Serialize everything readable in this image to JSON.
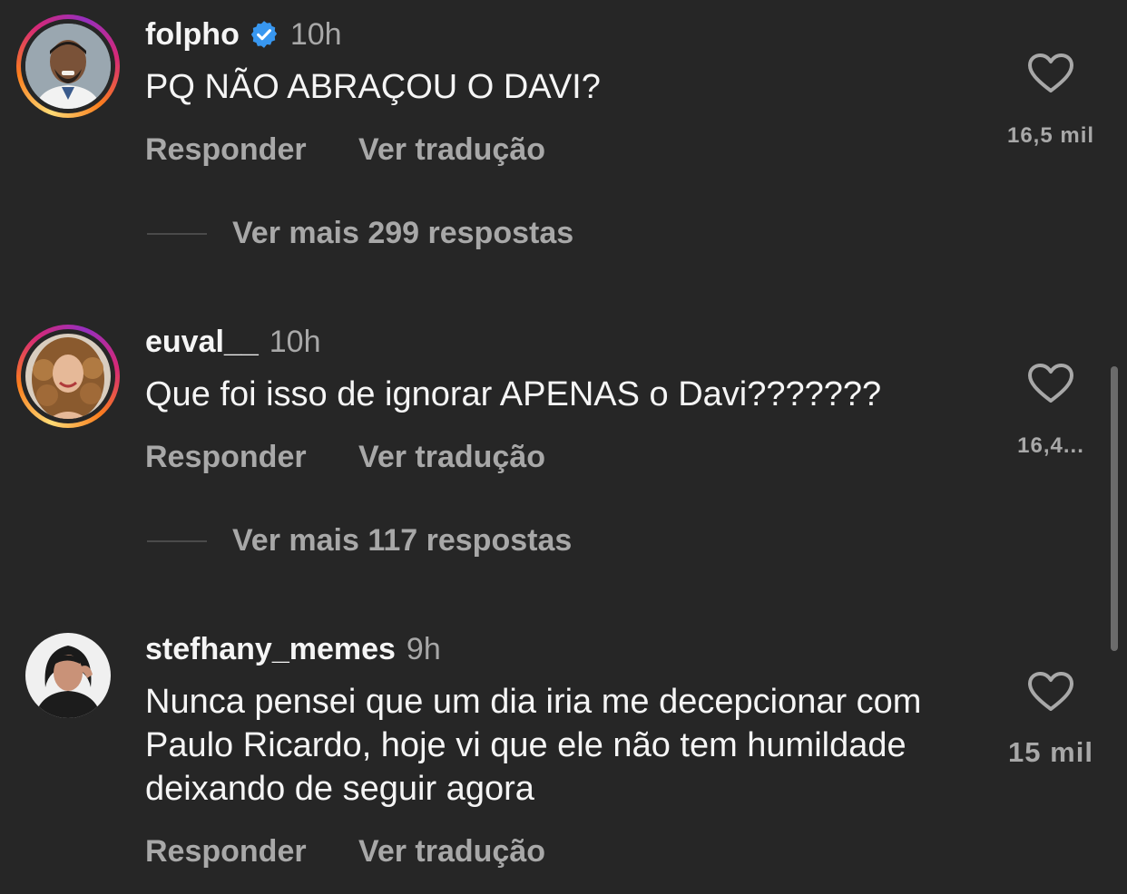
{
  "comments": [
    {
      "username": "folpho",
      "verified": true,
      "time": "10h",
      "text": "PQ NÃO ABRAÇOU O DAVI?",
      "reply_label": "Responder",
      "translate_label": "Ver tradução",
      "likes": "16,5 mil",
      "more_replies": "Ver mais 299 respostas",
      "has_story": true,
      "liked": false
    },
    {
      "username": "euval__",
      "verified": false,
      "time": "10h",
      "text": "Que foi isso de ignorar APENAS o Davi???????",
      "reply_label": "Responder",
      "translate_label": "Ver tradução",
      "likes": "16,4...",
      "more_replies": "Ver mais 117 respostas",
      "has_story": true,
      "liked": false
    },
    {
      "username": "stefhany_memes",
      "verified": false,
      "time": "9h",
      "text": "Nunca pensei que um dia iria me decepcionar com Paulo Ricardo, hoje vi que ele não tem humildade deixando de seguir agora",
      "reply_label": "Responder",
      "translate_label": "Ver tradução",
      "likes": "15 mil",
      "has_story": false,
      "liked": false
    }
  ],
  "colors": {
    "background": "#262626",
    "text_primary": "#f5f5f5",
    "text_secondary": "#a8a8a8",
    "verified_badge": "#3897f0"
  },
  "icons": {
    "verified": "verified-badge-icon",
    "like": "heart-outline-icon"
  }
}
